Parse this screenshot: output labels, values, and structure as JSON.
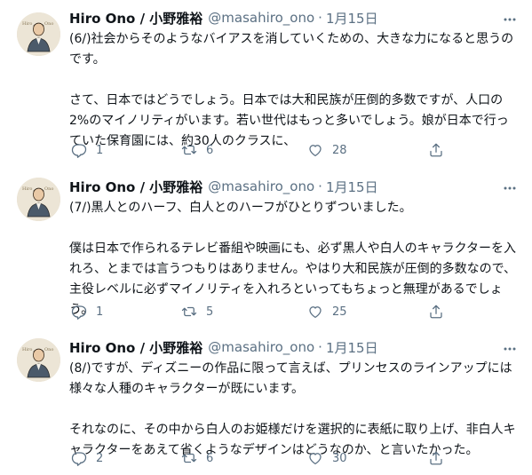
{
  "tweets": [
    {
      "display_name": "Hiro Ono / 小野雅裕",
      "handle": "@masahiro_ono",
      "dot": "·",
      "date": "1月15日",
      "paragraphs": [
        "(6/)社会からそのようなバイアスを消していくための、大きな力になると思うのです。",
        "さて、日本ではどうでしょう。日本では大和民族が圧倒的多数ですが、人口の2%のマイノリティがいます。若い世代はもっと多いでしょう。娘が日本で行っていた保育園には、約30人のクラスに、"
      ],
      "replies": "1",
      "retweets": "6",
      "likes": "28"
    },
    {
      "display_name": "Hiro Ono / 小野雅裕",
      "handle": "@masahiro_ono",
      "dot": "·",
      "date": "1月15日",
      "paragraphs": [
        "(7/)黒人とのハーフ、白人とのハーフがひとりずついました。",
        "僕は日本で作られるテレビ番組や映画にも、必ず黒人や白人のキャラクターを入れろ、とまでは言うつもりはありません。やはり大和民族が圧倒的多数なので、主役レベルに必ずマイノリティを入れろといってもちょっと無理があるでしょう。"
      ],
      "replies": "1",
      "retweets": "5",
      "likes": "25"
    },
    {
      "display_name": "Hiro Ono / 小野雅裕",
      "handle": "@masahiro_ono",
      "dot": "·",
      "date": "1月15日",
      "paragraphs": [
        "(8/)ですが、ディズニーの作品に限って言えば、プリンセスのラインアップには様々な人種のキャラクターが既にいます。",
        "それなのに、その中から白人のお姫様だけを選択的に表紙に取り上げ、非白人キャラクターをあえて省くようなデザインはどうなのか、と言いたかった。"
      ],
      "replies": "2",
      "retweets": "6",
      "likes": "30"
    }
  ],
  "icons": {
    "more": "more-horizontal-icon",
    "reply": "reply-icon",
    "retweet": "retweet-icon",
    "like": "like-heart-icon",
    "share": "share-icon"
  },
  "colors": {
    "text": "#0f1419",
    "secondary": "#5b7083",
    "background": "#ffffff"
  }
}
